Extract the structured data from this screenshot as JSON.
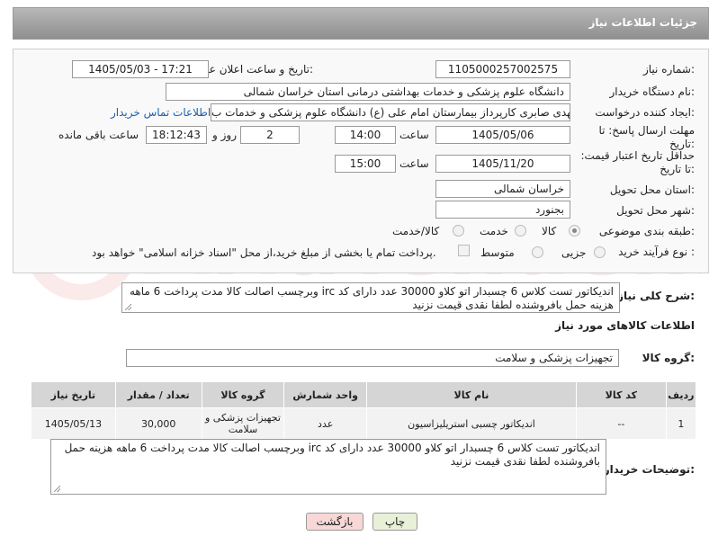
{
  "header": {
    "title": "جزئیات اطلاعات نیاز"
  },
  "form": {
    "need_number_label": "شماره نیاز:",
    "need_number": "1105000257002575",
    "announce_label": "تاریخ و ساعت اعلان عمومی:",
    "announce_value": "1405/05/03 - 17:21",
    "buyer_label": "نام دستگاه خریدار:",
    "buyer_value": "دانشگاه علوم پزشکی و خدمات بهداشتی درمانی استان خراسان شمالی",
    "requester_label": "ایجاد کننده درخواست:",
    "requester_value": "مهدی صابری کارپرداز بیمارستان امام علی (ع) دانشگاه علوم پزشکی و خدمات ب",
    "contact_link": "اطلاعات تماس خریدار",
    "deadline_label": "مهلت ارسال پاسخ: تا تاریخ:",
    "deadline_date": "1405/05/06",
    "time_label": "ساعت",
    "deadline_time": "14:00",
    "days_value": "2",
    "days_label": "روز و",
    "remaining_time": "18:12:43",
    "remaining_label": "ساعت باقی مانده",
    "validity_label": "حداقل تاریخ اعتبار قیمت: تا تاریخ:",
    "validity_date": "1405/11/20",
    "validity_time": "15:00",
    "province_label": "استان محل تحویل:",
    "province_value": "خراسان شمالی",
    "city_label": "شهر محل تحویل:",
    "city_value": "بجنورد",
    "category_label": "طبقه بندی موضوعی:",
    "category_options": [
      "کالا",
      "خدمت",
      "کالا/خدمت"
    ],
    "process_label": "نوع فرآیند خرید :",
    "process_options": [
      "جزیی",
      "متوسط"
    ],
    "process_note": "پرداخت تمام یا بخشی از مبلغ خرید،از محل \"اسناد خزانه اسلامی\" خواهد بود."
  },
  "description": {
    "label": "شرح کلی نیاز:",
    "text": "اندیکاتور تست کلاس 6 چسبدار اتو کلاو 30000 عدد دارای کد irc وبرچسب اصالت کالا مدت پرداخت 6 ماهه هزینه حمل بافروشنده لطفا نقدی قیمت نزنید"
  },
  "goods": {
    "section_title": "اطلاعات کالاهای مورد نیاز",
    "group_label": "گروه کالا:",
    "group_value": "تجهیزات پزشکی و سلامت",
    "columns": [
      "ردیف",
      "کد کالا",
      "نام کالا",
      "واحد شمارش",
      "گروه کالا",
      "تعداد / مقدار",
      "تاریخ نیاز"
    ],
    "rows": [
      {
        "row": "1",
        "code": "--",
        "name": "اندیکاتور چسبی استریلیزاسیون",
        "unit": "عدد",
        "group": "تجهیزات پزشکی و سلامت",
        "qty": "30,000",
        "date": "1405/05/13"
      }
    ]
  },
  "buyer_notes": {
    "label": "توضیحات خریدار:",
    "text": "اندیکاتور تست کلاس 6 چسبدار اتو کلاو 30000 عدد دارای کد irc وبرچسب اصالت کالا مدت پرداخت 6 ماهه هزینه حمل بافروشنده لطفا نقدی قیمت نزنید"
  },
  "buttons": {
    "print": "چاپ",
    "back": "بازگشت"
  },
  "watermark": "AriaTender.net",
  "colors": {
    "header": "#9e9e9e",
    "link": "#1a5fb4",
    "back_button": "#f8d7d7",
    "print_button": "#e8f0d8"
  }
}
